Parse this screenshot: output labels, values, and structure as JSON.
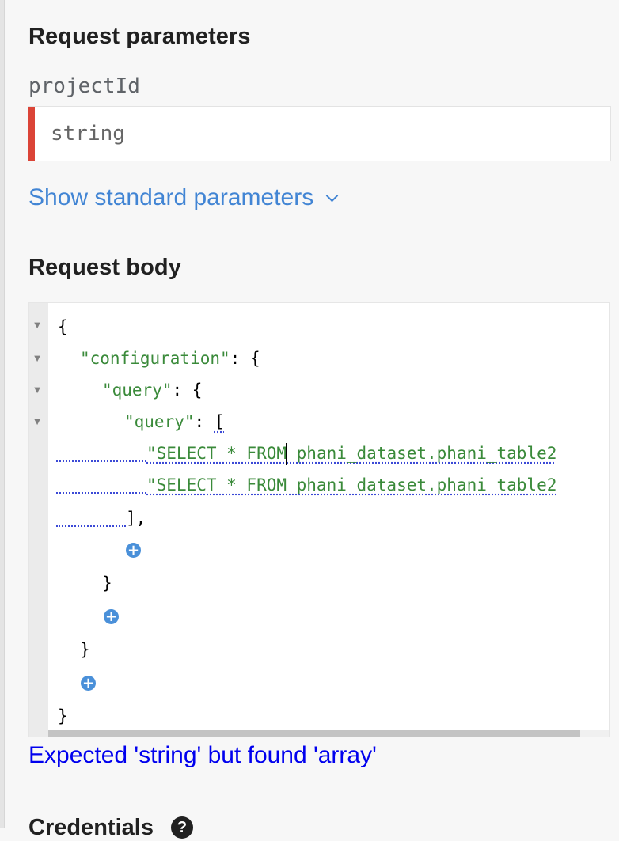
{
  "request_parameters": {
    "title": "Request parameters",
    "project_id": {
      "label": "projectId",
      "placeholder": "string",
      "value": ""
    },
    "show_standard_params_label": "Show standard parameters",
    "expand_icon": "chevron-down-icon"
  },
  "request_body": {
    "title": "Request body",
    "fold_icon": "triangle-down",
    "code": {
      "open_brace": "{",
      "configuration_key": "\"configuration\"",
      "query_obj_key": "\"query\"",
      "query_array_key": "\"query\"",
      "colon_brace": ": {",
      "colon_bracket": ": ",
      "open_bracket": "[",
      "sql_line_1_a": "\"SELECT * FROM",
      "sql_line_1_b": " phani_dataset.phani_table2",
      "sql_line_2": "\"SELECT * FROM phani_dataset.phani_table2",
      "close_bracket": "],",
      "close_brace": "}",
      "add_symbol": "+"
    },
    "error_message": "Expected 'string' but found 'array'"
  },
  "credentials": {
    "title": "Credentials",
    "help_symbol": "?"
  },
  "colors": {
    "required_bar": "#db4437",
    "link": "#4285d4",
    "string_literal": "#3a8a3a",
    "error": "#0000ee",
    "add_button": "#4a90d9"
  }
}
